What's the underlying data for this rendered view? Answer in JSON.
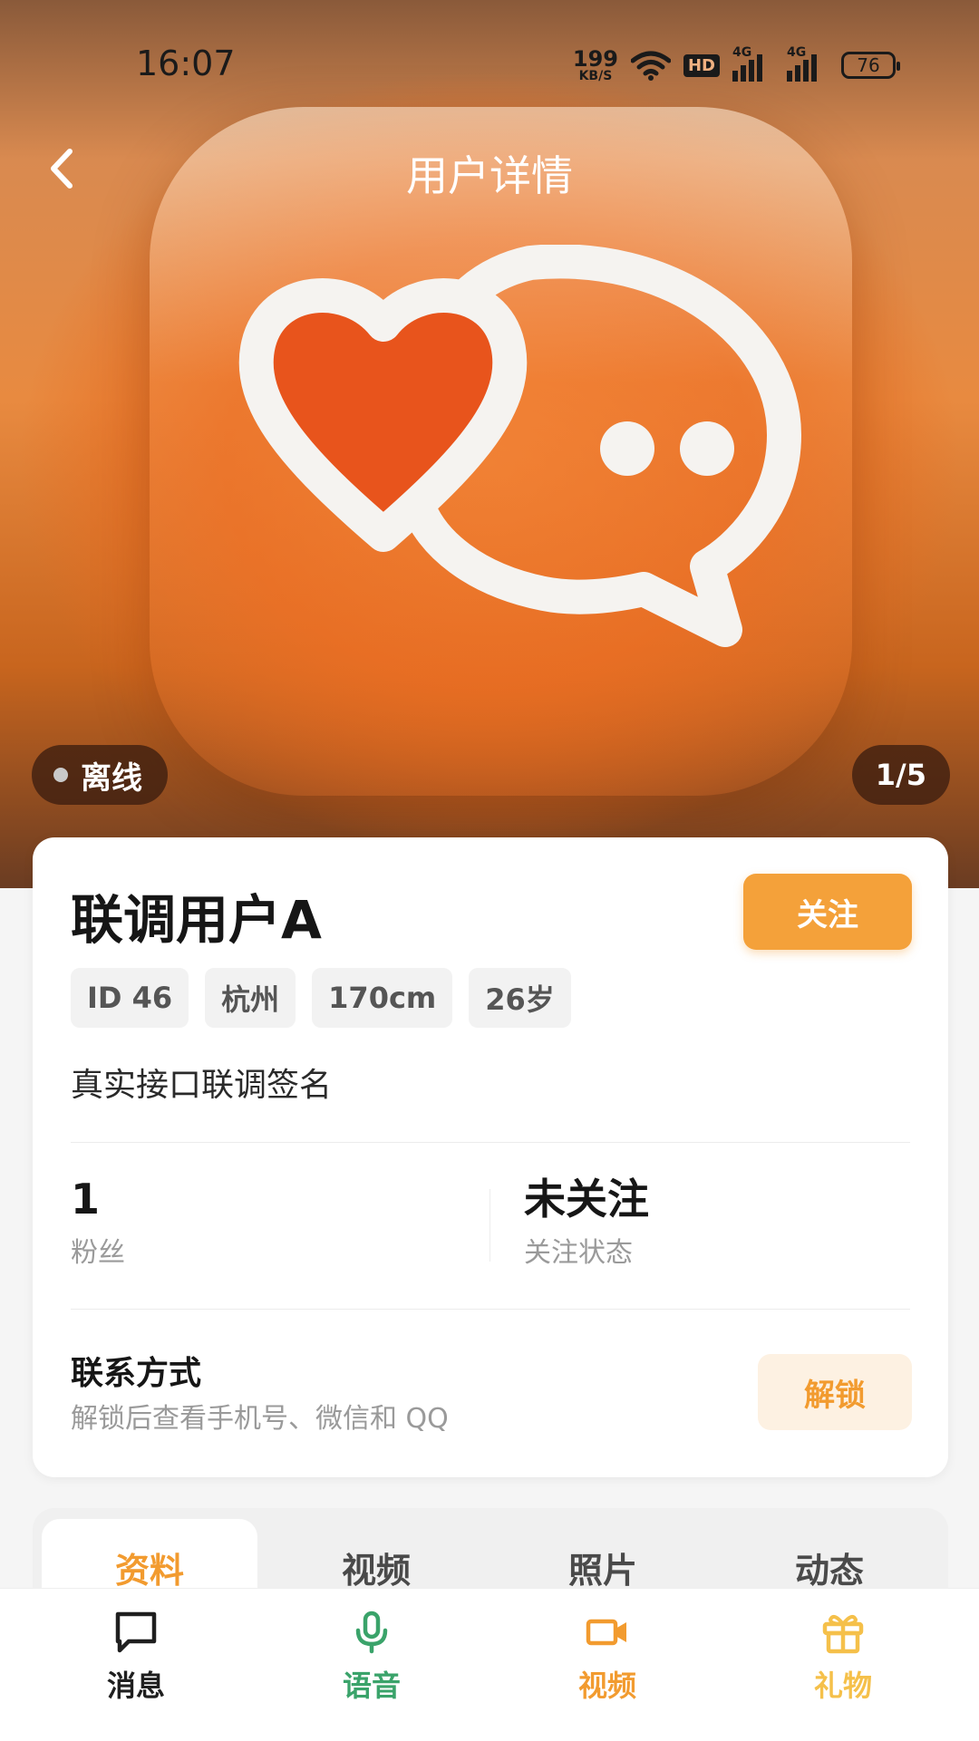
{
  "status_bar": {
    "time": "16:07",
    "net_speed_value": "199",
    "net_speed_unit": "KB/S",
    "hd_label": "HD",
    "signal1_label": "4G",
    "signal2_label": "4G",
    "battery": "76"
  },
  "nav": {
    "title": "用户详情"
  },
  "hero": {
    "online_status": "离线",
    "photo_counter": "1/5"
  },
  "profile": {
    "name": "联调用户A",
    "follow_label": "关注",
    "tags": [
      "ID 46",
      "杭州",
      "170cm",
      "26岁"
    ],
    "signature": "真实接口联调签名",
    "stats": [
      {
        "value": "1",
        "label": "粉丝"
      },
      {
        "value": "未关注",
        "label": "关注状态"
      }
    ],
    "contact": {
      "title": "联系方式",
      "description": "解锁后查看手机号、微信和 QQ",
      "unlock_label": "解锁"
    }
  },
  "tabs": [
    {
      "label": "资料",
      "active": true
    },
    {
      "label": "视频",
      "active": false
    },
    {
      "label": "照片",
      "active": false
    },
    {
      "label": "动态",
      "active": false
    }
  ],
  "bottom_nav": [
    {
      "label": "消息",
      "icon": "chat-bubble-icon",
      "color": "#1f1f1f"
    },
    {
      "label": "语音",
      "icon": "microphone-icon",
      "color": "#3aa36a"
    },
    {
      "label": "视频",
      "icon": "video-camera-icon",
      "color": "#f29b2f"
    },
    {
      "label": "礼物",
      "icon": "gift-icon",
      "color": "#f5c04a"
    }
  ],
  "colors": {
    "accent": "#f4a13a",
    "unlock_bg": "#fdf1e2",
    "voice_green": "#3aa36a",
    "gift_yellow": "#f5c04a"
  }
}
